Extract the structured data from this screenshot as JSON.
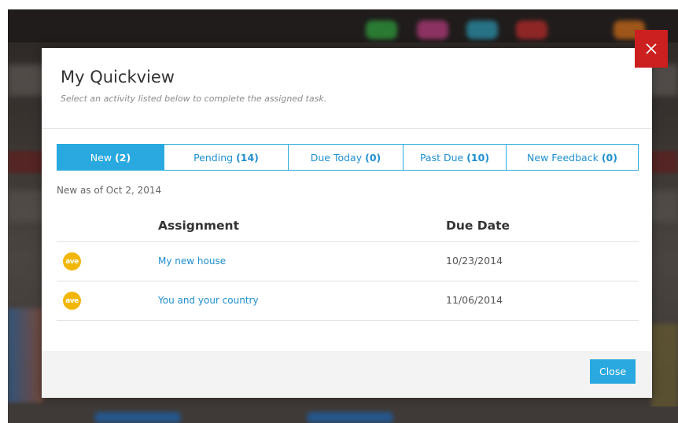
{
  "modal": {
    "title": "My Quickview",
    "subtitle": "Select an activity listed below to complete the assigned task.",
    "close_icon": "close-x-icon"
  },
  "tabs": [
    {
      "label": "New",
      "count": "(2)",
      "active": true
    },
    {
      "label": "Pending",
      "count": "(14)",
      "active": false
    },
    {
      "label": "Due Today",
      "count": "(0)",
      "active": false
    },
    {
      "label": "Past Due",
      "count": "(10)",
      "active": false
    },
    {
      "label": "New Feedback",
      "count": "(0)",
      "active": false
    }
  ],
  "status": {
    "new_as_of": "New as of Oct 2, 2014"
  },
  "table": {
    "headers": {
      "assignment": "Assignment",
      "due_date": "Due Date"
    },
    "rows": [
      {
        "icon_text": "ave",
        "assignment": "My new house",
        "due_date": "10/23/2014"
      },
      {
        "icon_text": "ave",
        "assignment": "You and your country",
        "due_date": "11/06/2014"
      }
    ]
  },
  "footer": {
    "close_label": "Close"
  },
  "colors": {
    "accent": "#29a9df",
    "link": "#1f8fd0",
    "close_red": "#cc1f1f",
    "ave_yellow": "#f2b705"
  }
}
